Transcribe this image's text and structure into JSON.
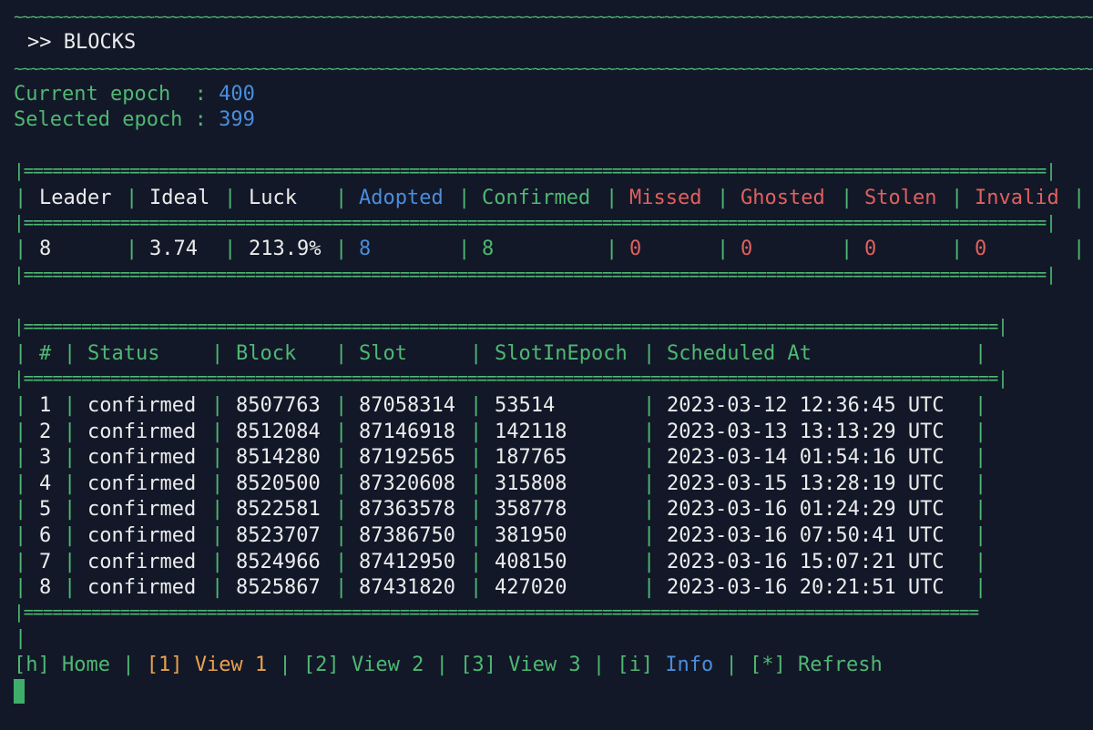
{
  "header": {
    "tilde_rule": "~~~~~~~~~~~~~~~~~~~~~~~~~~~~~~~~~~~~~~~~~~~~~~~~~~~~~~~~~~~~~~~~~~~~~~~~~~~~~~~~~~~~~~~~~~~~~~~~~~~~~~~~~~~~~~~~~~~~~~~~~~~~~~~~~~~~",
    "title": ">> BLOCKS"
  },
  "epochs": {
    "current_label": "Current epoch  : ",
    "current_value": "400",
    "selected_label": "Selected epoch : ",
    "selected_value": "399"
  },
  "summary": {
    "border_top": "|==========================================================================================================|",
    "headers": {
      "leader": "Leader",
      "ideal": "Ideal",
      "luck": "Luck",
      "adopted": "Adopted",
      "confirmed": "Confirmed",
      "missed": "Missed",
      "ghosted": "Ghosted",
      "stolen": "Stolen",
      "invalid": "Invalid"
    },
    "values": {
      "leader": "8",
      "ideal": "3.74",
      "luck": "213.9%",
      "adopted": "8",
      "confirmed": "8",
      "missed": "0",
      "ghosted": "0",
      "stolen": "0",
      "invalid": "0"
    }
  },
  "blocks_table": {
    "border": "|=====================================================================================================|",
    "headers": [
      "#",
      "Status",
      "Block",
      "Slot",
      "SlotInEpoch",
      "Scheduled At"
    ],
    "rows": [
      {
        "n": "1",
        "status": "confirmed",
        "block": "8507763",
        "slot": "87058314",
        "slot_in_epoch": "53514",
        "scheduled_at": "2023-03-12 12:36:45 UTC"
      },
      {
        "n": "2",
        "status": "confirmed",
        "block": "8512084",
        "slot": "87146918",
        "slot_in_epoch": "142118",
        "scheduled_at": "2023-03-13 13:13:29 UTC"
      },
      {
        "n": "3",
        "status": "confirmed",
        "block": "8514280",
        "slot": "87192565",
        "slot_in_epoch": "187765",
        "scheduled_at": "2023-03-14 01:54:16 UTC"
      },
      {
        "n": "4",
        "status": "confirmed",
        "block": "8520500",
        "slot": "87320608",
        "slot_in_epoch": "315808",
        "scheduled_at": "2023-03-15 13:28:19 UTC"
      },
      {
        "n": "5",
        "status": "confirmed",
        "block": "8522581",
        "slot": "87363578",
        "slot_in_epoch": "358778",
        "scheduled_at": "2023-03-16 01:24:29 UTC"
      },
      {
        "n": "6",
        "status": "confirmed",
        "block": "8523707",
        "slot": "87386750",
        "slot_in_epoch": "381950",
        "scheduled_at": "2023-03-16 07:50:41 UTC"
      },
      {
        "n": "7",
        "status": "confirmed",
        "block": "8524966",
        "slot": "87412950",
        "slot_in_epoch": "408150",
        "scheduled_at": "2023-03-16 15:07:21 UTC"
      },
      {
        "n": "8",
        "status": "confirmed",
        "block": "8525867",
        "slot": "87431820",
        "slot_in_epoch": "427020",
        "scheduled_at": "2023-03-16 20:21:51 UTC"
      }
    ],
    "bottom_border": "|==================================================================================================="
  },
  "menu": {
    "home": "[h] Home",
    "view1": "[1] View 1",
    "view2": "[2] View 2",
    "view3": "[3] View 3",
    "info_key": "[i] ",
    "info": "Info",
    "refresh": "[*] Refresh",
    "sep": " | ",
    "stub": "|"
  },
  "colors": {
    "background": "#121828",
    "green": "#4fb872",
    "blue": "#4a8ddc",
    "red": "#e0605e",
    "orange": "#e9a14f",
    "cursor": "#3fae6a"
  }
}
